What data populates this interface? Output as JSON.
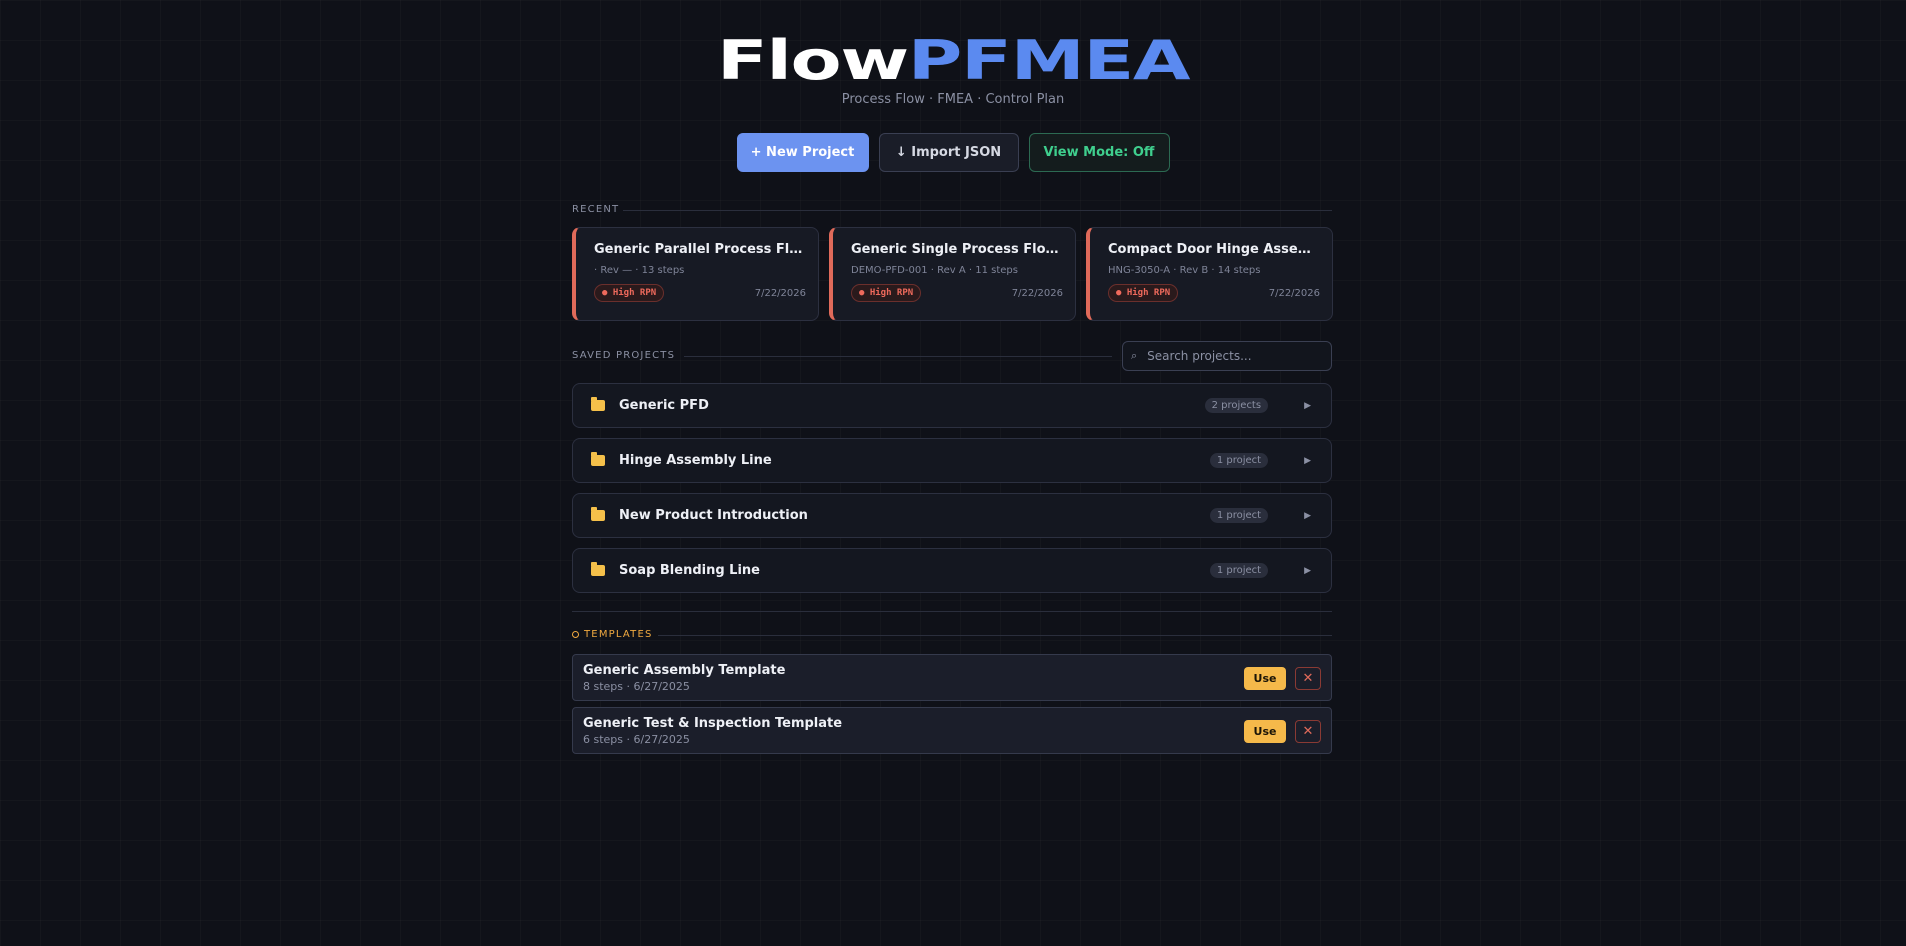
{
  "app": {
    "logo_part1": "Flow",
    "logo_part2": "PFMEA",
    "subtitle": "Process Flow · FMEA · Control Plan"
  },
  "actions": {
    "new_project": "+ New Project",
    "import_json": "↓ Import JSON",
    "view_mode": "View Mode: Off"
  },
  "recent": {
    "label": "RECENT",
    "cards": [
      {
        "title": "Generic Parallel Process Flow Sheet",
        "meta": "· Rev — · 13 steps",
        "badge": "● High RPN",
        "date": "7/22/2026"
      },
      {
        "title": "Generic Single Process Flow Sheet",
        "meta": "DEMO-PFD-001 · Rev A · 11 steps",
        "badge": "● High RPN",
        "date": "7/22/2026"
      },
      {
        "title": "Compact Door Hinge Assembly",
        "meta": "HNG-3050-A · Rev B · 14 steps",
        "badge": "● High RPN",
        "date": "7/22/2026"
      }
    ]
  },
  "saved": {
    "label": "SAVED PROJECTS",
    "search_placeholder": "Search projects...",
    "search_icon": "⌕",
    "folders": [
      {
        "name": "Generic PFD",
        "count": "2 projects"
      },
      {
        "name": "Hinge Assembly Line",
        "count": "1 project"
      },
      {
        "name": "New Product Introduction",
        "count": "1 project"
      },
      {
        "name": "Soap Blending Line",
        "count": "1 project"
      }
    ],
    "arrow": "▶"
  },
  "templates": {
    "label": "TEMPLATES",
    "use_label": "Use",
    "delete_label": "✕",
    "items": [
      {
        "title": "Generic Assembly Template",
        "meta": "8 steps · 6/27/2025"
      },
      {
        "title": "Generic Test & Inspection Template",
        "meta": "6 steps · 6/27/2025"
      }
    ]
  },
  "colors": {
    "accent": "#6c93f0",
    "brand_blue": "#5b8af0",
    "view_mode_green": "#3fcf8e",
    "high_rpn": "#ef6a5c",
    "folder": "#f5c04a",
    "template_orange": "#f0a940"
  }
}
